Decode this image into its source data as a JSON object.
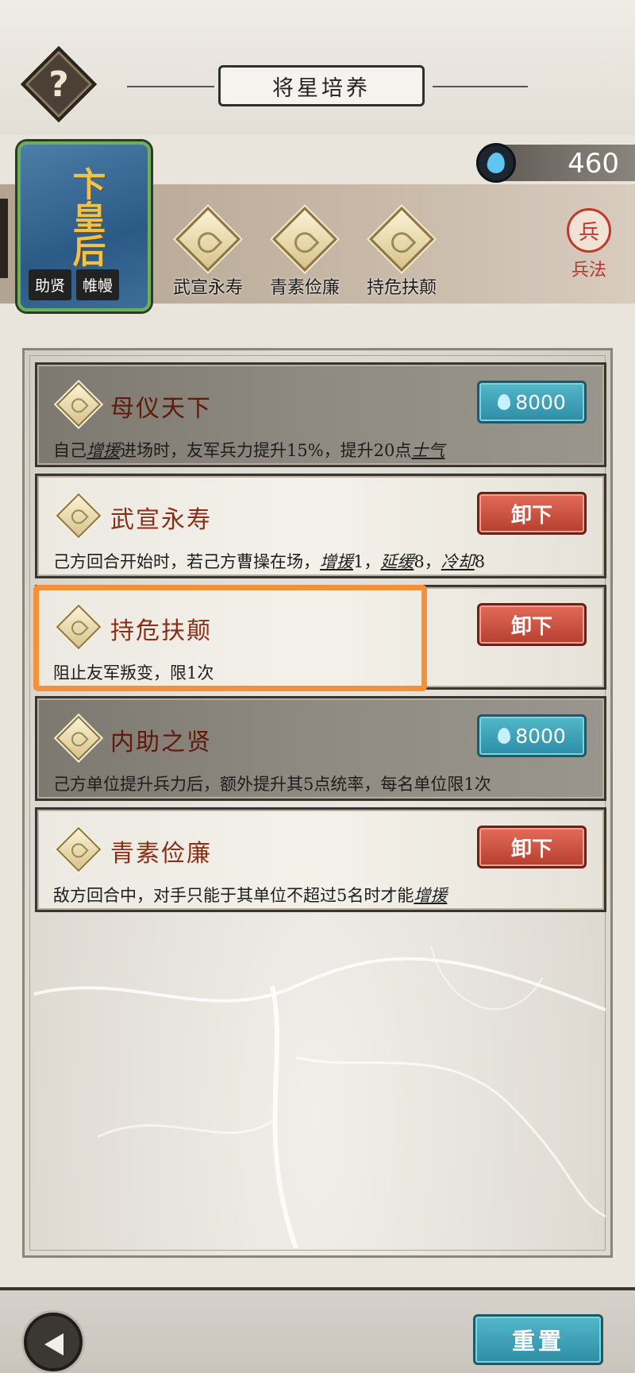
{
  "header": {
    "title": "将星培养",
    "help_symbol": "?"
  },
  "currency": {
    "icon": "blue-flame-icon",
    "amount": "460"
  },
  "hero": {
    "name": "卞皇后",
    "tags": [
      "助贤",
      "帷幔"
    ]
  },
  "equipped_skills": [
    {
      "label": "武宣永寿"
    },
    {
      "label": "青素俭廉"
    },
    {
      "label": "持危扶颠"
    }
  ],
  "bingfa": {
    "seal": "兵",
    "label": "兵法"
  },
  "cards": [
    {
      "name": "母仪天下",
      "desc_parts": [
        "自己",
        "增援",
        "进场时，友军兵力提升15%，提升20点",
        "士气",
        ""
      ],
      "button": "8000",
      "button_type": "buy"
    },
    {
      "name": "武宣永寿",
      "desc_parts": [
        "己方回合开始时，若己方曹操在场，",
        "增援",
        "1，",
        "延缓",
        "8，",
        "冷却",
        "8"
      ],
      "button": "卸下",
      "button_type": "remove"
    },
    {
      "name": "持危扶颠",
      "desc_parts": [
        "阻止友军叛变，限1次"
      ],
      "button": "卸下",
      "button_type": "remove"
    },
    {
      "name": "内助之贤",
      "desc_parts": [
        "己方单位提升兵力后，额外提升其5点统率，每名单位限1次"
      ],
      "button": "8000",
      "button_type": "buy"
    },
    {
      "name": "青素俭廉",
      "desc_parts": [
        "敌方回合中，对手只能于其单位不超过5名时才能",
        "增援"
      ],
      "button": "卸下",
      "button_type": "remove"
    }
  ],
  "footer": {
    "reset_label": "重置"
  },
  "colors": {
    "highlight": "#f5903a",
    "buy_button": "#2d8da6",
    "remove_button": "#b63e30",
    "skill_name": "#8a2f16"
  }
}
